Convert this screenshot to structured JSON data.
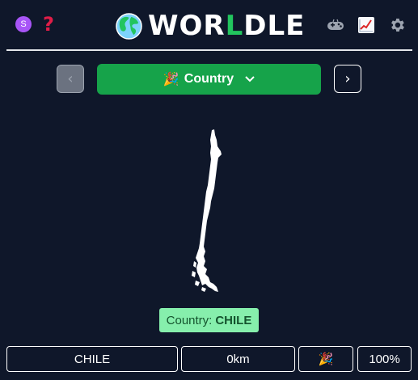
{
  "header": {
    "avatar_letter": "S",
    "help_glyph": "?",
    "logo_prefix": "WOR",
    "logo_highlight": "L",
    "logo_suffix": "DLE",
    "icons": [
      "avatar-icon",
      "help-icon",
      "globe-icon",
      "gamepad-icon",
      "stats-chart-icon",
      "gear-icon"
    ],
    "accent_color": "#22c55e"
  },
  "nav": {
    "prev_glyph": "‹",
    "next_glyph": "›",
    "mode_emoji": "🎉",
    "mode_label": "Country",
    "mode_color": "#16a34a"
  },
  "answer": {
    "label": "Country:",
    "value": "CHILE",
    "color": "#86efac"
  },
  "guess": {
    "country": "CHILE",
    "distance": "0km",
    "direction_emoji": "🎉",
    "proximity": "100%"
  }
}
